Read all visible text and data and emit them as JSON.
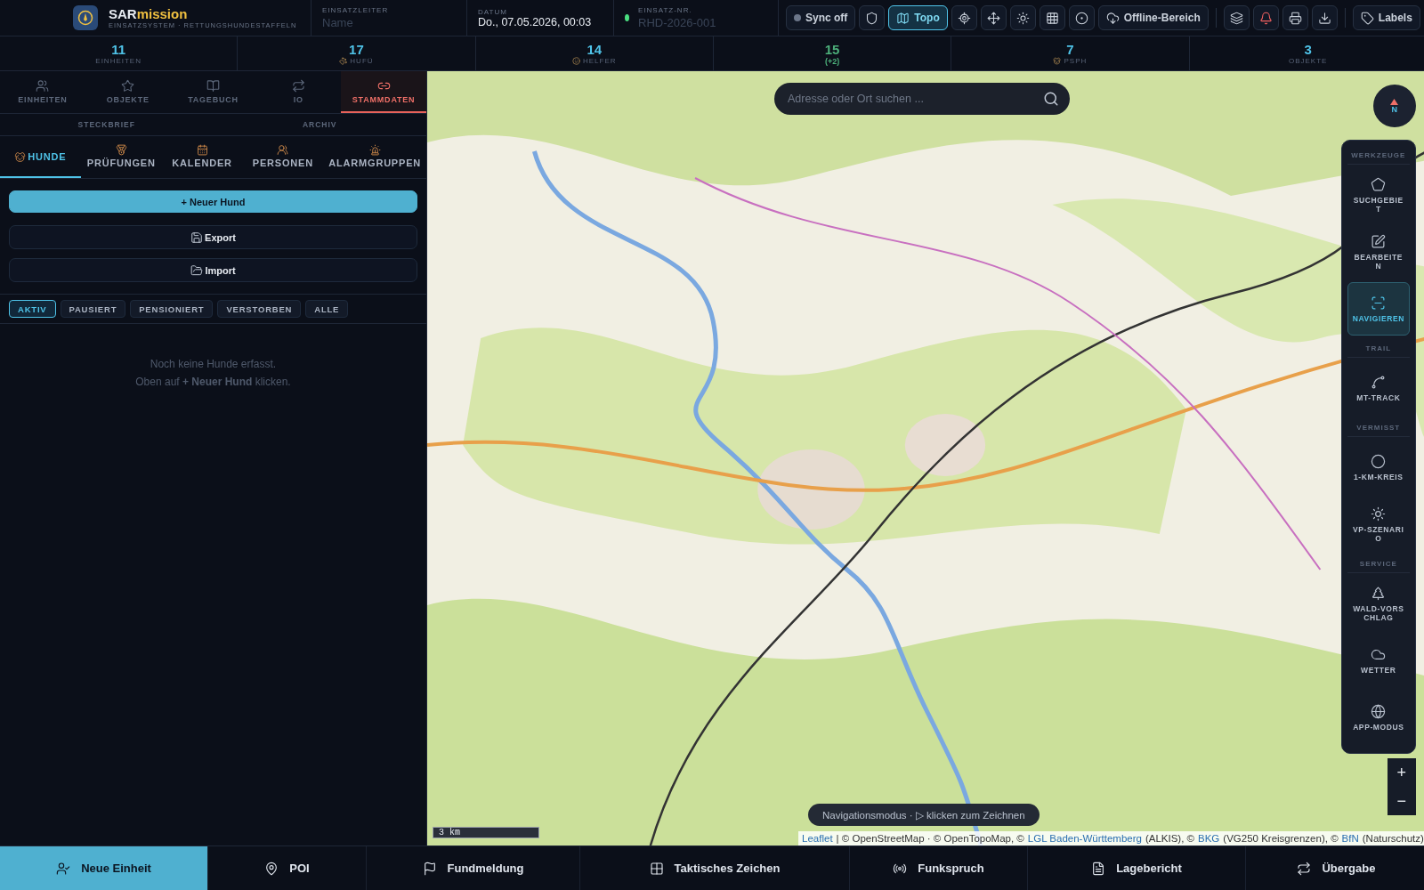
{
  "header": {
    "brand_a": "SAR",
    "brand_b": "mission",
    "subtitle": "EINSATZSYSTEM · RETTUNGSHUNDESTAFFELN",
    "fields": [
      {
        "label": "EINSATZLEITER",
        "placeholder": "Name"
      },
      {
        "label": "DATUM",
        "value": "Do., 07.05.2026, 00:03"
      },
      {
        "label": "EINSATZ-NR.",
        "placeholder": "RHD-2026-001",
        "color": "#4ade80"
      }
    ],
    "toolbar": [
      {
        "label": "Sync off",
        "selected": false
      },
      {
        "selected": false
      },
      {
        "label": "Topo",
        "selected": true
      },
      {
        "selected": false
      },
      {
        "selected": false
      },
      {
        "selected": false
      },
      {
        "selected": false
      },
      {
        "selected": false
      },
      {
        "label": "Offline-Bereich",
        "selected": false
      },
      {
        "selected": false
      },
      {
        "selected": false
      },
      {
        "selected": false
      },
      {
        "selected": false
      },
      {
        "label": "Labels",
        "selected": false
      }
    ]
  },
  "stats": [
    {
      "value": "11",
      "label": "EINHEITEN",
      "color": "#4fc3e8"
    },
    {
      "value": "17",
      "label": "HUFÜ",
      "color": "#4fc3e8"
    },
    {
      "value": "14",
      "label": "HELFER",
      "color": "#4fc3e8"
    },
    {
      "value": "15",
      "sub": "(+2)",
      "color": "#4caf7a"
    },
    {
      "value": "7",
      "label": "PSPH",
      "color": "#4fc3e8"
    },
    {
      "value": "3",
      "label": "OBJEKTE",
      "color": "#4fc3e8"
    }
  ],
  "sidebar": {
    "tabs": [
      {
        "label": "EINHEITEN",
        "selected": false
      },
      {
        "label": "OBJEKTE",
        "selected": false
      },
      {
        "label": "TAGEBUCH",
        "selected": false
      },
      {
        "label": "IO",
        "selected": false
      },
      {
        "label": "STAMMDATEN",
        "selected": true
      }
    ],
    "subtabs": [
      "STECKBRIEF",
      "ARCHIV"
    ],
    "inner_tabs": [
      {
        "label": "HUNDE",
        "selected": true
      },
      {
        "label": "PRÜFUNGEN",
        "selected": false
      },
      {
        "label": "KALENDER",
        "selected": false
      },
      {
        "label": "PERSONEN",
        "selected": false
      },
      {
        "label": "ALARMGRUPPEN",
        "selected": false
      }
    ],
    "buttons": [
      {
        "label": "+ Neuer Hund",
        "kind": "primary"
      },
      {
        "label": "Export",
        "kind": "export"
      },
      {
        "label": "Import",
        "kind": "import"
      }
    ],
    "filters": [
      {
        "label": "AKTIV",
        "selected": true
      },
      {
        "label": "PAUSIERT",
        "selected": false
      },
      {
        "label": "PENSIONIERT",
        "selected": false
      },
      {
        "label": "VERSTORBEN",
        "selected": false
      },
      {
        "label": "ALLE",
        "selected": false
      }
    ],
    "empty": [
      "Noch keine Hunde erfasst.",
      "Oben auf **+ Neuer Hund** klicken."
    ]
  },
  "map": {
    "search": {
      "placeholder": "Adresse oder Ort suchen ..."
    },
    "compass": "N",
    "tools": [
      {
        "section": "WERKZEUGE",
        "items": [
          {
            "label": "SUCHGEBIET",
            "selected": false
          },
          {
            "label": "BEARBEITEN",
            "selected": false
          },
          {
            "label": "NAVIGIEREN",
            "selected": true
          }
        ]
      },
      {
        "section": "TRAIL",
        "items": [
          {
            "label": "MT-TRACK",
            "selected": false
          }
        ]
      },
      {
        "section": "VERMISST",
        "items": [
          {
            "label": "1-KM-KREIS",
            "selected": false
          },
          {
            "label": "VP-SZENARIO",
            "selected": false
          }
        ]
      },
      {
        "section": "SERVICE",
        "items": [
          {
            "label": "WALD-VORSCHLAG",
            "selected": false
          },
          {
            "label": "WETTER",
            "selected": false
          },
          {
            "label": "APP-MODUS",
            "selected": false
          }
        ]
      }
    ],
    "zoom": [
      "+",
      "−"
    ],
    "scale": "3 km",
    "hint": "Navigationsmodus · ▷ klicken zum Zeichnen",
    "attribution": [
      {
        "text": "Leaflet",
        "link": true
      },
      {
        "text": "| © OpenStreetMap · © OpenTopoMap, ©",
        "link": false
      },
      {
        "text": "LGL Baden-Württemberg",
        "link": true
      },
      {
        "text": "(ALKIS), ©",
        "link": false
      },
      {
        "text": "BKG",
        "link": true
      },
      {
        "text": "(VG250 Kreisgrenzen), ©",
        "link": false
      },
      {
        "text": "BfN",
        "link": true
      },
      {
        "text": "(Naturschutz)",
        "link": false
      }
    ]
  },
  "actions": [
    {
      "label": "Neue Einheit",
      "selected": true
    },
    {
      "label": "POI",
      "selected": false
    },
    {
      "label": "Fundmeldung",
      "selected": false
    },
    {
      "label": "Taktisches Zeichen",
      "selected": false
    },
    {
      "label": "Funkspruch",
      "selected": false
    },
    {
      "label": "Lagebericht",
      "selected": false
    },
    {
      "label": "Übergabe",
      "selected": false
    }
  ]
}
